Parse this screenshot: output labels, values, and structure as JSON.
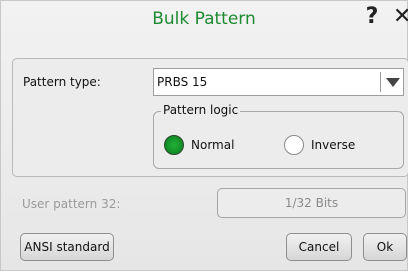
{
  "dialog": {
    "title": "Bulk Pattern",
    "help_glyph": "?",
    "close_glyph": "✕",
    "title_color": "#1e8a32"
  },
  "pattern_type": {
    "label": "Pattern type:",
    "selected": "PRBS 15"
  },
  "pattern_logic": {
    "legend": "Pattern logic",
    "options": [
      {
        "label": "Normal",
        "selected": true
      },
      {
        "label": "Inverse",
        "selected": false
      }
    ]
  },
  "user_pattern": {
    "label": "User pattern 32:",
    "value": "1/32 Bits"
  },
  "buttons": {
    "ansi": "ANSI standard",
    "cancel": "Cancel",
    "ok": "Ok"
  },
  "icons": {
    "help": "help-icon",
    "close": "close-icon",
    "dropdown": "chevron-down-icon"
  }
}
